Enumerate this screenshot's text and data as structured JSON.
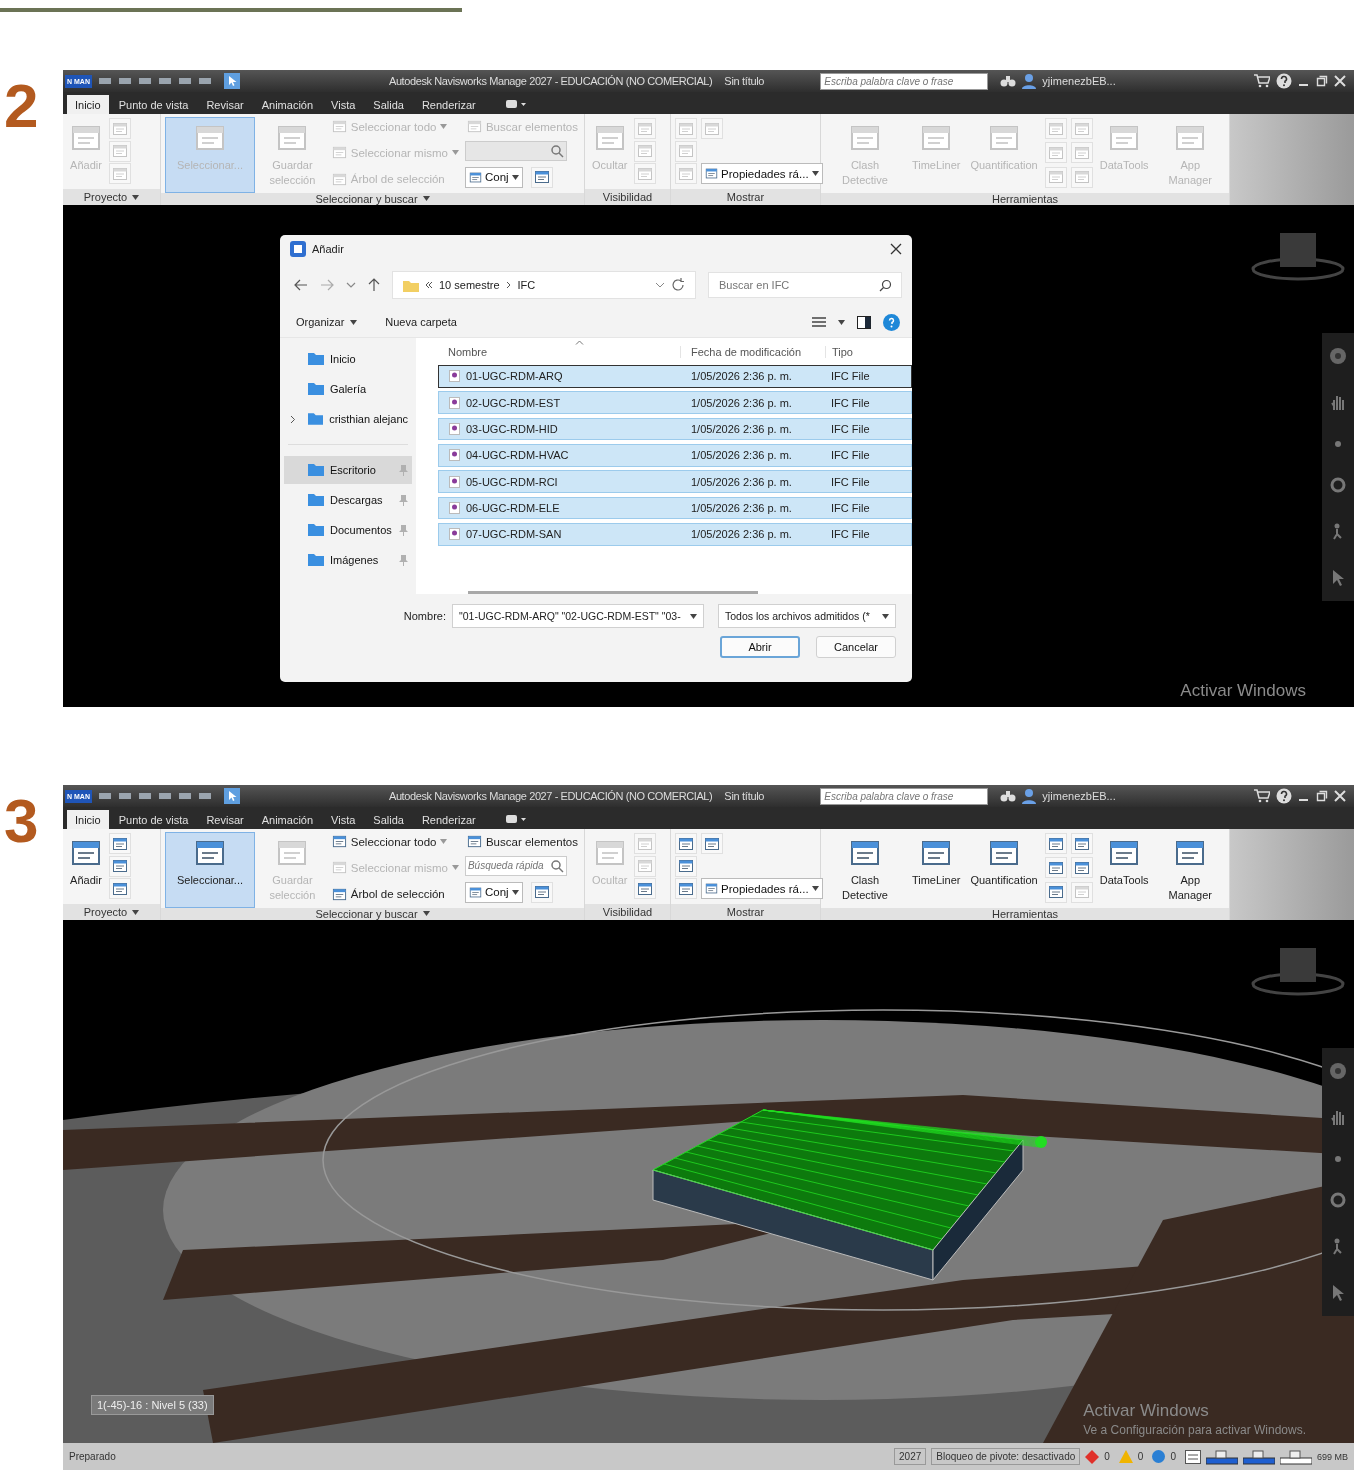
{
  "steps": [
    {
      "number": "2",
      "app": {
        "logo": "N MAN",
        "title": "Autodesk Navisworks Manage 2027 - EDUCACIÓN (NO COMERCIAL)",
        "document": "Sin título",
        "search_placeholder": "Escriba palabra clave o frase",
        "user": "yjimenezbEB...",
        "tabs": [
          {
            "label": "Inicio",
            "selected": true
          },
          {
            "label": "Punto de vista",
            "selected": false
          },
          {
            "label": "Revisar",
            "selected": false
          },
          {
            "label": "Animación",
            "selected": false
          },
          {
            "label": "Vista",
            "selected": false
          },
          {
            "label": "Salida",
            "selected": false
          },
          {
            "label": "Renderizar",
            "selected": false
          }
        ],
        "ribbon": [
          {
            "title": "Proyecto",
            "caret": true,
            "tools": [
              {
                "kind": "large",
                "label": "Añadir",
                "enabled": false
              },
              {
                "kind": "column",
                "items": [
                  {
                    "kind": "icon",
                    "enabled": false
                  },
                  {
                    "kind": "icon",
                    "enabled": false
                  },
                  {
                    "kind": "icon",
                    "enabled": false
                  }
                ]
              }
            ]
          },
          {
            "title": "Seleccionar y buscar",
            "caret": true,
            "tools": [
              {
                "kind": "large",
                "label": "Seleccionar...",
                "enabled": false,
                "selected": true
              },
              {
                "kind": "large",
                "label": "Guardar selección",
                "enabled": false
              },
              {
                "kind": "column",
                "items": [
                  {
                    "kind": "small",
                    "label": "Seleccionar todo",
                    "enabled": false,
                    "caret": true
                  },
                  {
                    "kind": "small",
                    "label": "Seleccionar mismo",
                    "enabled": false,
                    "caret": true
                  },
                  {
                    "kind": "small",
                    "label": "Árbol de selección",
                    "enabled": false
                  }
                ]
              },
              {
                "kind": "column",
                "items": [
                  {
                    "kind": "small",
                    "label": "Buscar elementos",
                    "enabled": false
                  },
                  {
                    "kind": "field",
                    "enabled": false
                  },
                  {
                    "kind": "dropdown",
                    "label": "Conj",
                    "enabled": true,
                    "trailing_icon": true
                  }
                ]
              }
            ]
          },
          {
            "title": "Visibilidad",
            "caret": false,
            "tools": [
              {
                "kind": "large",
                "label": "Ocultar",
                "enabled": false
              },
              {
                "kind": "column",
                "items": [
                  {
                    "kind": "icon",
                    "enabled": false
                  },
                  {
                    "kind": "icon",
                    "enabled": false
                  },
                  {
                    "kind": "icon",
                    "enabled": false
                  }
                ]
              }
            ]
          },
          {
            "title": "Mostrar",
            "caret": false,
            "tools": [
              {
                "kind": "column",
                "items": [
                  {
                    "kind": "icon",
                    "enabled": false
                  },
                  {
                    "kind": "icon",
                    "enabled": false
                  },
                  {
                    "kind": "icon",
                    "enabled": false
                  }
                ]
              },
              {
                "kind": "column",
                "items": [
                  {
                    "kind": "icon",
                    "enabled": false
                  },
                  {
                    "kind": "dropdown",
                    "label": "Propiedades rá...",
                    "enabled": true,
                    "trailing_icon": false
                  }
                ]
              }
            ]
          },
          {
            "title": "Herramientas",
            "caret": false,
            "tools": [
              {
                "kind": "large",
                "label": "Clash Detective",
                "enabled": false
              },
              {
                "kind": "large",
                "label": "TimeLiner",
                "enabled": false
              },
              {
                "kind": "large",
                "label": "Quantification",
                "enabled": false
              },
              {
                "kind": "column",
                "items": [
                  {
                    "kind": "icon",
                    "enabled": false
                  },
                  {
                    "kind": "icon",
                    "enabled": false
                  },
                  {
                    "kind": "icon",
                    "enabled": false
                  }
                ]
              },
              {
                "kind": "column",
                "items": [
                  {
                    "kind": "icon",
                    "enabled": false
                  },
                  {
                    "kind": "icon",
                    "enabled": false
                  },
                  {
                    "kind": "icon",
                    "enabled": false
                  }
                ]
              },
              {
                "kind": "large",
                "label": "DataTools",
                "enabled": false
              },
              {
                "kind": "large",
                "label": "App Manager",
                "enabled": false
              }
            ]
          }
        ],
        "viewport": {
          "kind": "dialog",
          "activation": [
            "Activar Windows"
          ],
          "dialog": {
            "title": "Añadir",
            "path": [
              "10 semestre",
              "IFC"
            ],
            "search_placeholder": "Buscar en IFC",
            "toolbar": [
              "Organizar",
              "Nueva carpeta"
            ],
            "sidebar": [
              {
                "items": [
                  {
                    "label": "Inicio",
                    "selected": false,
                    "expandable": false,
                    "pinned": false
                  },
                  {
                    "label": "Galería",
                    "selected": false,
                    "expandable": false,
                    "pinned": false
                  },
                  {
                    "label": "cristhian alejanc",
                    "selected": false,
                    "expandable": true,
                    "pinned": false
                  }
                ]
              },
              {
                "items": [
                  {
                    "label": "Escritorio",
                    "selected": true,
                    "expandable": false,
                    "pinned": true
                  },
                  {
                    "label": "Descargas",
                    "selected": false,
                    "expandable": false,
                    "pinned": true
                  },
                  {
                    "label": "Documentos",
                    "selected": false,
                    "expandable": false,
                    "pinned": true
                  },
                  {
                    "label": "Imágenes",
                    "selected": false,
                    "expandable": false,
                    "pinned": true
                  }
                ]
              }
            ],
            "columns": [
              "Nombre",
              "Fecha de modificación",
              "Tipo"
            ],
            "rows": [
              {
                "name": "01-UGC-RDM-ARQ",
                "date": "1/05/2026 2:36 p. m.",
                "type": "IFC File",
                "selected": true
              },
              {
                "name": "02-UGC-RDM-EST",
                "date": "1/05/2026 2:36 p. m.",
                "type": "IFC File",
                "selected": true
              },
              {
                "name": "03-UGC-RDM-HID",
                "date": "1/05/2026 2:36 p. m.",
                "type": "IFC File",
                "selected": true
              },
              {
                "name": "04-UGC-RDM-HVAC",
                "date": "1/05/2026 2:36 p. m.",
                "type": "IFC File",
                "selected": true
              },
              {
                "name": "05-UGC-RDM-RCI",
                "date": "1/05/2026 2:36 p. m.",
                "type": "IFC File",
                "selected": true
              },
              {
                "name": "06-UGC-RDM-ELE",
                "date": "1/05/2026 2:36 p. m.",
                "type": "IFC File",
                "selected": true
              },
              {
                "name": "07-UGC-RDM-SAN",
                "date": "1/05/2026 2:36 p. m.",
                "type": "IFC File",
                "selected": true
              }
            ],
            "filename_label": "Nombre:",
            "filename": "\"01-UGC-RDM-ARQ\" \"02-UGC-RDM-EST\" \"03-",
            "filetype": "Todos los archivos admitidos (*",
            "buttons": [
              "Abrir",
              "Cancelar"
            ]
          }
        }
      }
    },
    {
      "number": "3",
      "app": {
        "logo": "N MAN",
        "title": "Autodesk Navisworks Manage 2027 - EDUCACIÓN (NO COMERCIAL)",
        "document": "Sin título",
        "search_placeholder": "Escriba palabra clave o frase",
        "user": "yjimenezbEB...",
        "tabs": [
          {
            "label": "Inicio",
            "selected": true
          },
          {
            "label": "Punto de vista",
            "selected": false
          },
          {
            "label": "Revisar",
            "selected": false
          },
          {
            "label": "Animación",
            "selected": false
          },
          {
            "label": "Vista",
            "selected": false
          },
          {
            "label": "Salida",
            "selected": false
          },
          {
            "label": "Renderizar",
            "selected": false
          }
        ],
        "ribbon": [
          {
            "title": "Proyecto",
            "caret": true,
            "tools": [
              {
                "kind": "large",
                "label": "Añadir",
                "enabled": true
              },
              {
                "kind": "column",
                "items": [
                  {
                    "kind": "icon",
                    "enabled": true
                  },
                  {
                    "kind": "icon",
                    "enabled": true
                  },
                  {
                    "kind": "icon",
                    "enabled": true
                  }
                ]
              }
            ]
          },
          {
            "title": "Seleccionar y buscar",
            "caret": true,
            "tools": [
              {
                "kind": "large",
                "label": "Seleccionar...",
                "enabled": true,
                "selected": true
              },
              {
                "kind": "large",
                "label": "Guardar selección",
                "enabled": false
              },
              {
                "kind": "column",
                "items": [
                  {
                    "kind": "small",
                    "label": "Seleccionar todo",
                    "enabled": true,
                    "caret": true
                  },
                  {
                    "kind": "small",
                    "label": "Seleccionar mismo",
                    "enabled": false,
                    "caret": true
                  },
                  {
                    "kind": "small",
                    "label": "Árbol de selección",
                    "enabled": true
                  }
                ]
              },
              {
                "kind": "column",
                "items": [
                  {
                    "kind": "small",
                    "label": "Buscar elementos",
                    "enabled": true
                  },
                  {
                    "kind": "field",
                    "enabled": true,
                    "placeholder": "Búsqueda rápida"
                  },
                  {
                    "kind": "dropdown",
                    "label": "Conj",
                    "enabled": true,
                    "trailing_icon": true
                  }
                ]
              }
            ]
          },
          {
            "title": "Visibilidad",
            "caret": false,
            "tools": [
              {
                "kind": "large",
                "label": "Ocultar",
                "enabled": false
              },
              {
                "kind": "column",
                "items": [
                  {
                    "kind": "icon",
                    "enabled": false
                  },
                  {
                    "kind": "icon",
                    "enabled": false
                  },
                  {
                    "kind": "icon",
                    "enabled": true
                  }
                ]
              }
            ]
          },
          {
            "title": "Mostrar",
            "caret": false,
            "tools": [
              {
                "kind": "column",
                "items": [
                  {
                    "kind": "icon",
                    "enabled": true
                  },
                  {
                    "kind": "icon",
                    "enabled": true
                  },
                  {
                    "kind": "icon",
                    "enabled": true
                  }
                ]
              },
              {
                "kind": "column",
                "items": [
                  {
                    "kind": "icon",
                    "enabled": true
                  },
                  {
                    "kind": "dropdown",
                    "label": "Propiedades rá...",
                    "enabled": true,
                    "trailing_icon": false
                  }
                ]
              }
            ]
          },
          {
            "title": "Herramientas",
            "caret": false,
            "tools": [
              {
                "kind": "large",
                "label": "Clash Detective",
                "enabled": true
              },
              {
                "kind": "large",
                "label": "TimeLiner",
                "enabled": true
              },
              {
                "kind": "large",
                "label": "Quantification",
                "enabled": true
              },
              {
                "kind": "column",
                "items": [
                  {
                    "kind": "icon",
                    "enabled": true
                  },
                  {
                    "kind": "icon",
                    "enabled": true
                  },
                  {
                    "kind": "icon",
                    "enabled": true
                  }
                ]
              },
              {
                "kind": "column",
                "items": [
                  {
                    "kind": "icon",
                    "enabled": true
                  },
                  {
                    "kind": "icon",
                    "enabled": true
                  },
                  {
                    "kind": "icon",
                    "enabled": false
                  }
                ]
              },
              {
                "kind": "large",
                "label": "DataTools",
                "enabled": true
              },
              {
                "kind": "large",
                "label": "App Manager",
                "enabled": true
              }
            ]
          }
        ],
        "viewport": {
          "kind": "model",
          "level_label": "1(-45)-16 : Nivel 5 (33)",
          "activation": [
            "Activar Windows",
            "Ve a Configuración para activar Windows."
          ]
        },
        "status_bar": {
          "message": "Preparado",
          "fields": [
            "2027",
            "Bloqueo de pivote: desactivado"
          ],
          "counts": [
            {
              "kind": "error",
              "value": "0",
              "color": "#e0302a"
            },
            {
              "kind": "warning",
              "value": "0",
              "color": "#f0b400"
            },
            {
              "kind": "info",
              "value": "0",
              "color": "#2a7fd4"
            }
          ],
          "memory": "699 MB"
        }
      }
    }
  ]
}
